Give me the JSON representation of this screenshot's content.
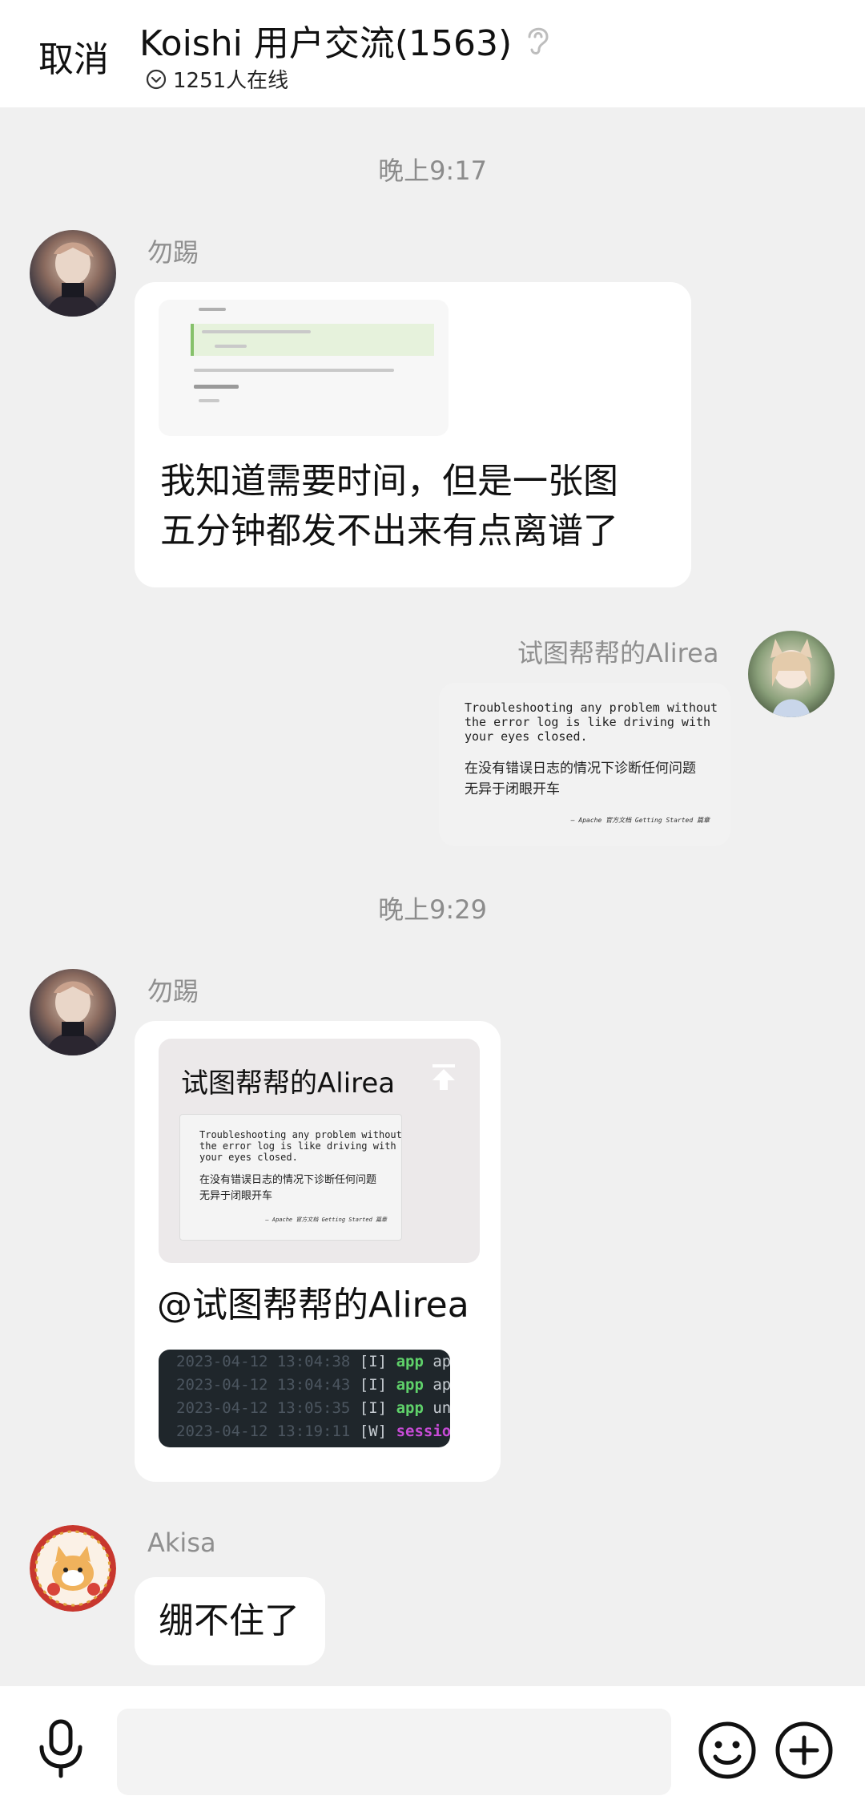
{
  "header": {
    "cancel_label": "取消",
    "title": "Koishi 用户交流(1563)",
    "online": "1251人在线"
  },
  "messages": {
    "time1": "晚上9:17",
    "msg1": {
      "sender": "勿踢",
      "text_line1": "我知道需要时间，但是一张图",
      "text_line2": "五分钟都发不出来有点离谱了"
    },
    "msg2": {
      "sender": "试图帮帮的Alirea",
      "quote_en": "Troubleshooting any problem without\nthe error log is like driving with\nyour eyes closed.",
      "quote_zh": "在没有错误日志的情况下诊断任何问题\n无异于闭眼开车",
      "quote_attr": "— Apache 官方文档 Getting Started 篇章"
    },
    "time2": "晚上9:29",
    "msg3": {
      "sender": "勿踢",
      "reply_name": "试图帮帮的Alirea",
      "mention": "@试图帮帮的Alirea",
      "log_lines": [
        {
          "ts": "2023-04-12 13:04:38",
          "lv": "[I]",
          "tag": "app",
          "rest": "appl"
        },
        {
          "ts": "2023-04-12 13:04:43",
          "lv": "[I]",
          "tag": "app",
          "rest": "appl"
        },
        {
          "ts": "2023-04-12 13:05:35",
          "lv": "[I]",
          "tag": "app",
          "rest": "unlo"
        },
        {
          "ts": "2023-04-12 13:19:11",
          "lv": "[W]",
          "tag": "session",
          "rest": ""
        }
      ]
    },
    "msg4": {
      "sender": "Akisa",
      "text": "绷不住了"
    }
  },
  "input": {
    "placeholder": ""
  },
  "colors": {
    "background": "#f0f0f0",
    "bubble": "#ffffff",
    "timestamp": "#8c8c8c",
    "log_green": "#5fd16a",
    "log_purple": "#c74bd6"
  },
  "icons": {
    "ear": "ear-icon",
    "online": "chevron-circle-icon",
    "mic": "microphone-icon",
    "emoji": "smiley-icon",
    "plus": "plus-circle-icon"
  }
}
